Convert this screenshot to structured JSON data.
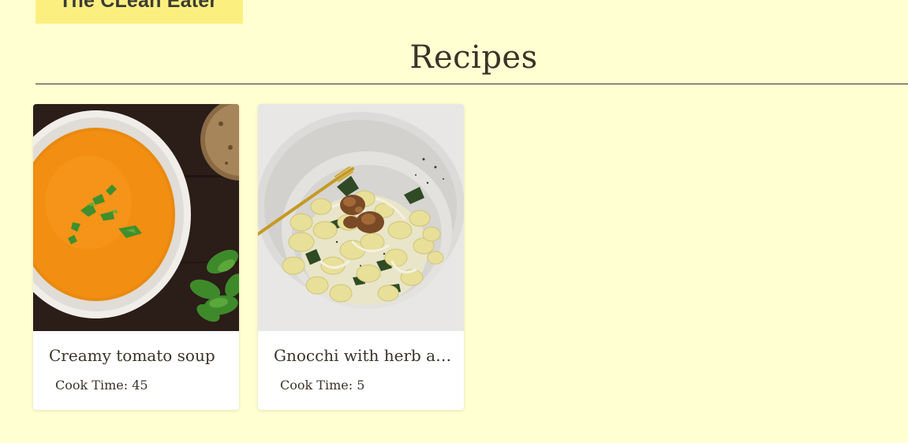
{
  "header": {
    "logo_text": "The CLean Eater"
  },
  "main": {
    "title": "Recipes"
  },
  "recipes": [
    {
      "title": "Creamy tomato soup",
      "cook_time_label": "Cook Time:",
      "cook_time": "45",
      "image_icon": "tomato-soup-photo"
    },
    {
      "title": "Gnocchi with herb and walnut pesto",
      "cook_time_label": "Cook Time:",
      "cook_time": "5",
      "image_icon": "gnocchi-photo"
    }
  ],
  "colors": {
    "background": "#ffffd1",
    "logo_background": "#fbf07f",
    "text": "#3b3328",
    "card_background": "#ffffff"
  }
}
